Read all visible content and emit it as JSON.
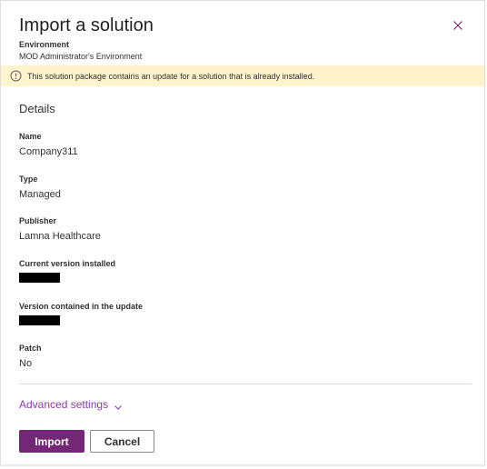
{
  "dialog": {
    "title": "Import a solution",
    "environment_label": "Environment",
    "environment_value": "MOD Administrator's Environment",
    "close_icon": "close-icon"
  },
  "banner": {
    "icon": "info-icon",
    "text": "This solution package contains an update for a solution that is already installed.",
    "background_color": "#fff4ce"
  },
  "details": {
    "section_title": "Details",
    "fields": [
      {
        "label": "Name",
        "value": "Company311"
      },
      {
        "label": "Type",
        "value": "Managed"
      },
      {
        "label": "Publisher",
        "value": "Lamna Healthcare"
      },
      {
        "label": "Current version installed",
        "value_redacted": true
      },
      {
        "label": "Version contained in the update",
        "value_redacted": true
      },
      {
        "label": "Patch",
        "value": "No"
      }
    ]
  },
  "advanced": {
    "label": "Advanced settings",
    "icon": "chevron-down-icon"
  },
  "actions": {
    "import_label": "Import",
    "cancel_label": "Cancel",
    "primary_color": "#742774"
  }
}
